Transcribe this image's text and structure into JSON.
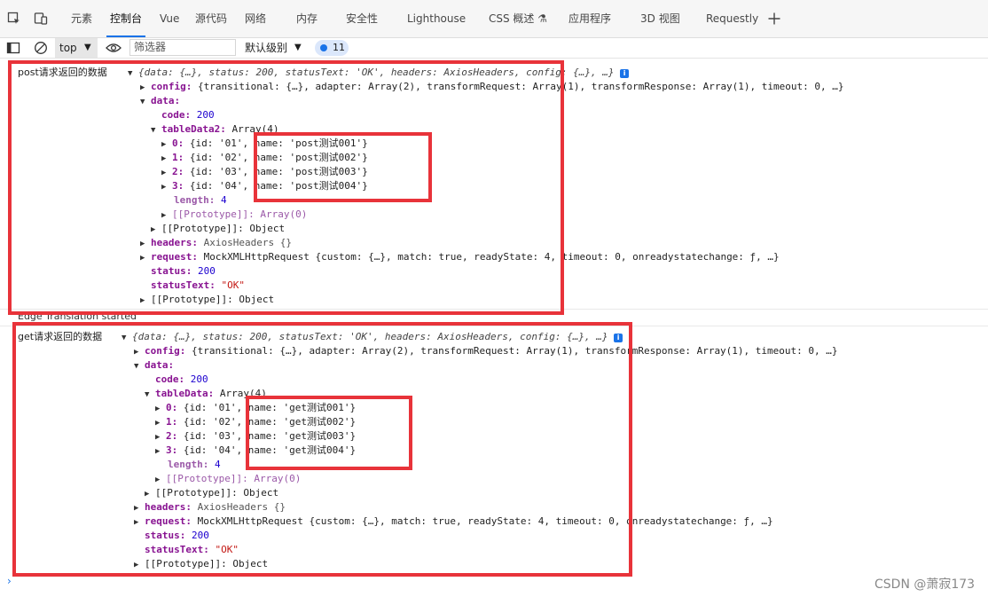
{
  "tabs": [
    {
      "label": "元素",
      "active": false
    },
    {
      "label": "控制台",
      "active": true
    },
    {
      "label": "Vue",
      "active": false
    },
    {
      "label": "源代码",
      "active": false
    },
    {
      "label": "网络",
      "active": false
    },
    {
      "label": "内存",
      "active": false
    },
    {
      "label": "安全性",
      "active": false
    },
    {
      "label": "Lighthouse",
      "active": false
    },
    {
      "label": "CSS 概述",
      "active": false
    },
    {
      "label": "应用程序",
      "active": false
    },
    {
      "label": "3D 视图",
      "active": false
    },
    {
      "label": "Requestly",
      "active": false
    }
  ],
  "toolbar": {
    "context": "top",
    "filter_placeholder": "筛选器",
    "level": "默认级别",
    "issues_count": "11"
  },
  "post_log": {
    "label": "post请求返回的数据",
    "summary": "{data: {…}, status: 200, statusText: 'OK', headers: AxiosHeaders, config: {…}, …}",
    "config_key": "config:",
    "config_val": "{transitional: {…}, adapter: Array(2), transformRequest: Array(1), transformResponse: Array(1), timeout: 0, …}",
    "data_key": "data:",
    "code_key": "code:",
    "code_val": "200",
    "table_key": "tableData2:",
    "table_val": "Array(4)",
    "rows": [
      {
        "idx": "0:",
        "text": "{id: '01', name: 'post测试001'}"
      },
      {
        "idx": "1:",
        "text": "{id: '02', name: 'post测试002'}"
      },
      {
        "idx": "2:",
        "text": "{id: '03', name: 'post测试003'}"
      },
      {
        "idx": "3:",
        "text": "{id: '04', name: 'post测试004'}"
      }
    ],
    "length_key": "length:",
    "length_val": "4",
    "proto_array": "[[Prototype]]: Array(0)",
    "proto_object_inner": "[[Prototype]]: Object",
    "headers_key": "headers:",
    "headers_val": "AxiosHeaders {}",
    "request_key": "request:",
    "request_val": "MockXMLHttpRequest {custom: {…}, match: true, readyState: 4, timeout: 0, onreadystatechange: ƒ, …}",
    "status_key": "status:",
    "status_val": "200",
    "statusText_key": "statusText:",
    "statusText_val": "\"OK\"",
    "proto_object": "[[Prototype]]: Object"
  },
  "edge_message": "Edge Translation started",
  "get_log": {
    "label": "get请求返回的数据",
    "summary": "{data: {…}, status: 200, statusText: 'OK', headers: AxiosHeaders, config: {…}, …}",
    "config_key": "config:",
    "config_val": "{transitional: {…}, adapter: Array(2), transformRequest: Array(1), transformResponse: Array(1), timeout: 0, …}",
    "data_key": "data:",
    "code_key": "code:",
    "code_val": "200",
    "table_key": "tableData:",
    "table_val": "Array(4)",
    "rows": [
      {
        "idx": "0:",
        "text": "{id: '01', name: 'get测试001'}"
      },
      {
        "idx": "1:",
        "text": "{id: '02', name: 'get测试002'}"
      },
      {
        "idx": "2:",
        "text": "{id: '03', name: 'get测试003'}"
      },
      {
        "idx": "3:",
        "text": "{id: '04', name: 'get测试004'}"
      }
    ],
    "length_key": "length:",
    "length_val": "4",
    "proto_array": "[[Prototype]]: Array(0)",
    "proto_object_inner": "[[Prototype]]: Object",
    "headers_key": "headers:",
    "headers_val": "AxiosHeaders {}",
    "request_key": "request:",
    "request_val": "MockXMLHttpRequest {custom: {…}, match: true, readyState: 4, timeout: 0, onreadystatechange: ƒ, …}",
    "status_key": "status:",
    "status_val": "200",
    "statusText_key": "statusText:",
    "statusText_val": "\"OK\"",
    "proto_object": "[[Prototype]]: Object"
  },
  "prompt_symbol": "›",
  "watermark": "CSDN @萧寂173",
  "colors": {
    "annotation_red": "#e8333a",
    "accent": "#1a73e8"
  }
}
